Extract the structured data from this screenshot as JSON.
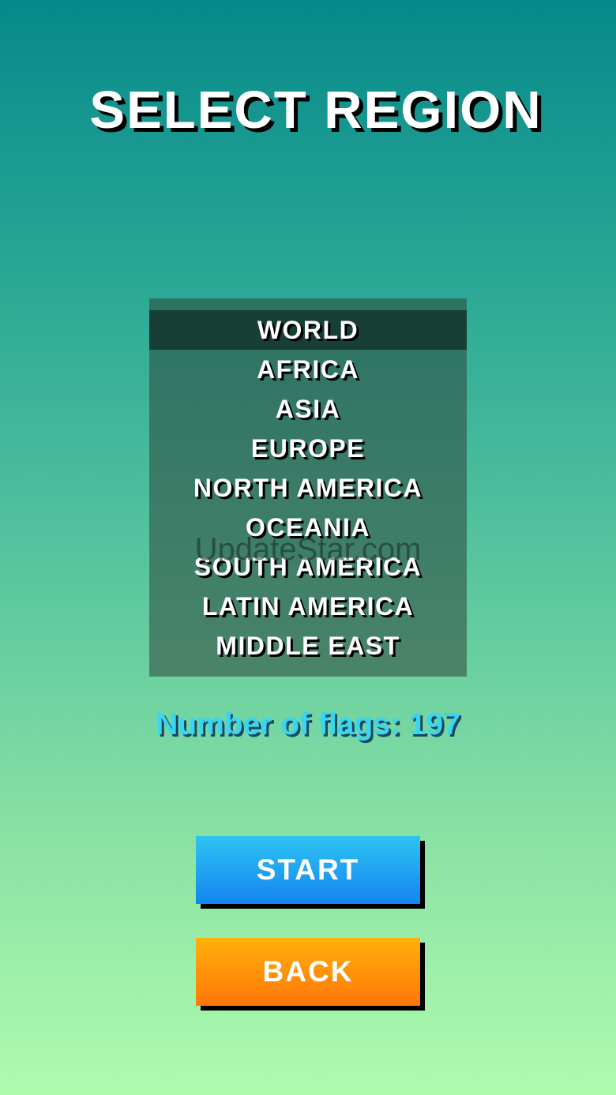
{
  "title": "SELECT REGION",
  "regions": {
    "items": [
      {
        "label": "WORLD",
        "selected": true
      },
      {
        "label": "AFRICA",
        "selected": false
      },
      {
        "label": "ASIA",
        "selected": false
      },
      {
        "label": "EUROPE",
        "selected": false
      },
      {
        "label": "NORTH AMERICA",
        "selected": false
      },
      {
        "label": "OCEANIA",
        "selected": false
      },
      {
        "label": "SOUTH AMERICA",
        "selected": false
      },
      {
        "label": "LATIN AMERICA",
        "selected": false
      },
      {
        "label": "MIDDLE EAST",
        "selected": false
      }
    ]
  },
  "watermark": "UpdateStar.com",
  "flag_count": "Number of flags: 197",
  "buttons": {
    "start_label": "START",
    "back_label": "BACK"
  },
  "colors": {
    "background_top": "#07898a",
    "background_bottom": "#b0fbae",
    "selected_row": "#173f35",
    "flag_count_text": "#38d6f0",
    "start_button": "#1a9af0",
    "back_button": "#ff9508"
  }
}
